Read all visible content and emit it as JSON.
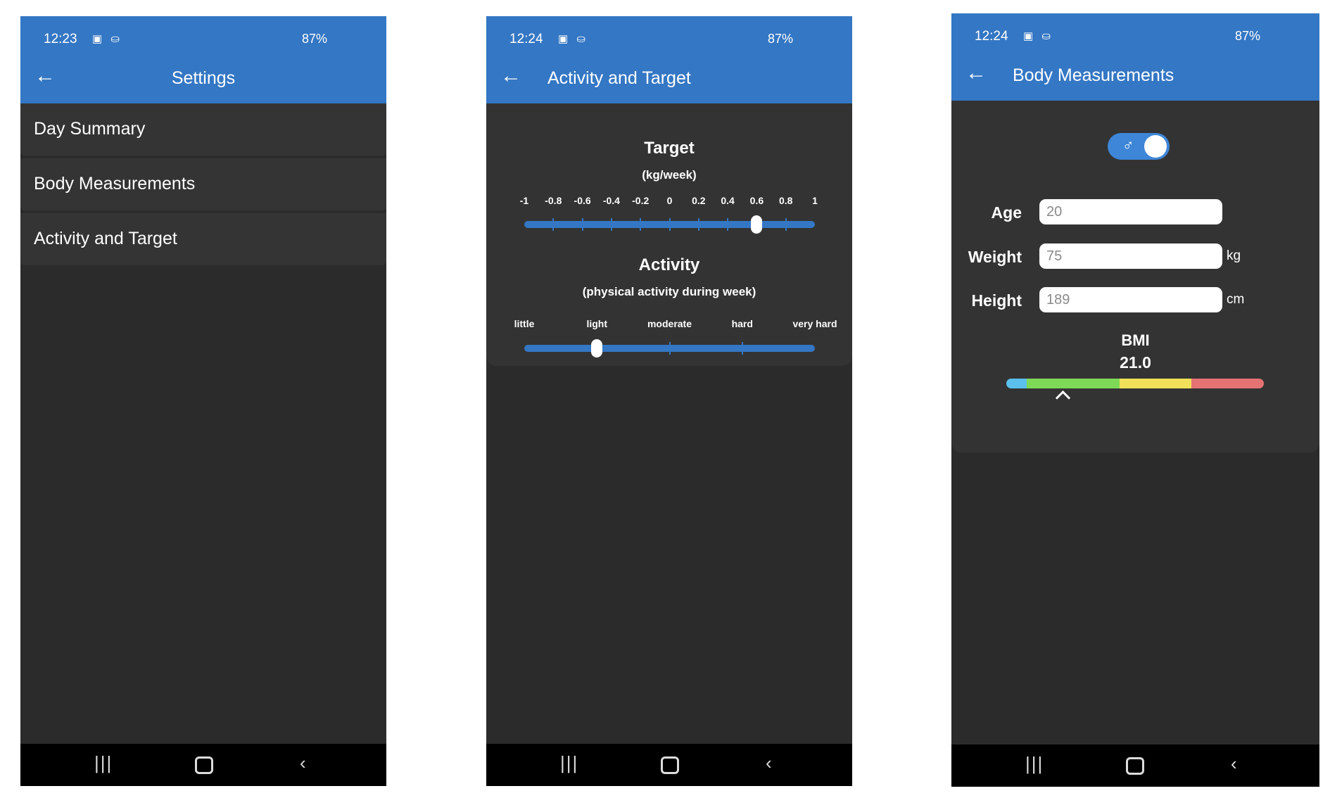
{
  "status": {
    "phone1_time": "12:23",
    "phone2_time": "12:24",
    "phone3_time": "12:24",
    "battery": "87%"
  },
  "settings_screen": {
    "title": "Settings",
    "items": [
      "Day Summary",
      "Body Measurements",
      "Activity and Target"
    ]
  },
  "activity_screen": {
    "title": "Activity and Target",
    "target_heading": "Target",
    "target_unit": "(kg/week)",
    "target_ticks": [
      "-1",
      "-0.8",
      "-0.6",
      "-0.4",
      "-0.2",
      "0",
      "0.2",
      "0.4",
      "0.6",
      "0.8",
      "1"
    ],
    "target_value": 0.6,
    "activity_heading": "Activity",
    "activity_sub": "(physical activity during week)",
    "activity_levels": [
      "little",
      "light",
      "moderate",
      "hard",
      "very hard"
    ],
    "activity_selected": "light"
  },
  "body_screen": {
    "title": "Body Measurements",
    "gender_symbol": "♂",
    "age_label": "Age",
    "age_value": "20",
    "weight_label": "Weight",
    "weight_value": "75",
    "weight_unit": "kg",
    "height_label": "Height",
    "height_value": "189",
    "height_unit": "cm",
    "bmi_label": "BMI",
    "bmi_value": "21.0"
  },
  "colors": {
    "accent": "#3477c4",
    "background": "#2b2b2b",
    "bmi_underweight": "#5bc0eb",
    "bmi_normal": "#7ed957",
    "bmi_overweight": "#f1e05a",
    "bmi_obese": "#e57373"
  },
  "icons": {
    "back": "arrow-left-icon",
    "nav_recents": "recents-icon",
    "nav_home": "home-icon",
    "nav_back": "chevron-left-icon"
  }
}
